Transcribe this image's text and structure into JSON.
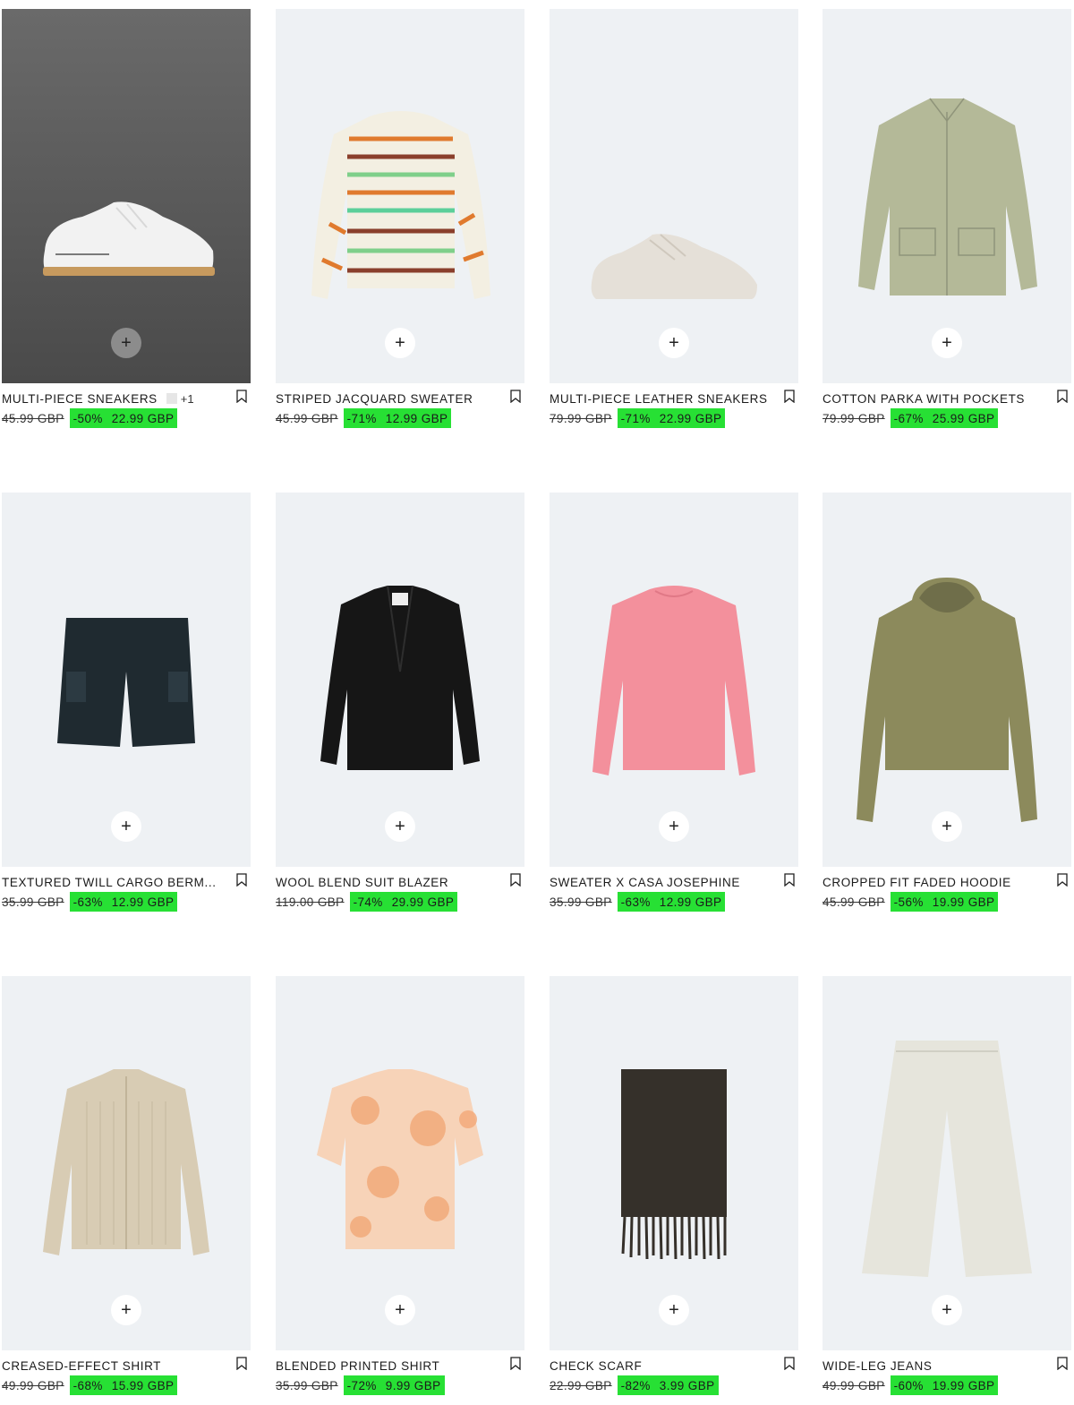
{
  "products": [
    {
      "name": "MULTI-PIECE SNEAKERS",
      "extra_colors": "+1",
      "old_price": "45.99 GBP",
      "discount": "-50%",
      "new_price": "22.99 GBP",
      "image": "white-sneaker"
    },
    {
      "name": "STRIPED JACQUARD SWEATER",
      "old_price": "45.99 GBP",
      "discount": "-71%",
      "new_price": "12.99 GBP",
      "image": "striped-sweater"
    },
    {
      "name": "MULTI-PIECE LEATHER SNEAKERS",
      "old_price": "79.99 GBP",
      "discount": "-71%",
      "new_price": "22.99 GBP",
      "image": "beige-sneaker"
    },
    {
      "name": "COTTON PARKA WITH POCKETS",
      "old_price": "79.99 GBP",
      "discount": "-67%",
      "new_price": "25.99 GBP",
      "image": "green-parka"
    },
    {
      "name": "TEXTURED TWILL CARGO BERM...",
      "old_price": "35.99 GBP",
      "discount": "-63%",
      "new_price": "12.99 GBP",
      "image": "cargo-shorts"
    },
    {
      "name": "WOOL BLEND SUIT BLAZER",
      "old_price": "119.00 GBP",
      "discount": "-74%",
      "new_price": "29.99 GBP",
      "image": "black-blazer"
    },
    {
      "name": "SWEATER X CASA JOSEPHINE",
      "old_price": "35.99 GBP",
      "discount": "-63%",
      "new_price": "12.99 GBP",
      "image": "pink-sweater"
    },
    {
      "name": "CROPPED FIT FADED HOODIE",
      "old_price": "45.99 GBP",
      "discount": "-56%",
      "new_price": "19.99 GBP",
      "image": "olive-hoodie"
    },
    {
      "name": "CREASED-EFFECT SHIRT",
      "old_price": "49.99 GBP",
      "discount": "-68%",
      "new_price": "15.99 GBP",
      "image": "beige-shirt"
    },
    {
      "name": "BLENDED PRINTED SHIRT",
      "old_price": "35.99 GBP",
      "discount": "-72%",
      "new_price": "9.99 GBP",
      "image": "tie-dye-shirt"
    },
    {
      "name": "CHECK SCARF",
      "old_price": "22.99 GBP",
      "discount": "-82%",
      "new_price": "3.99 GBP",
      "image": "brown-scarf"
    },
    {
      "name": "WIDE-LEG JEANS",
      "old_price": "49.99 GBP",
      "discount": "-60%",
      "new_price": "19.99 GBP",
      "image": "ecru-jeans"
    }
  ],
  "add_label": "+",
  "colors": {
    "sale_highlight": "#27e034",
    "image_bg": "#eef1f4"
  }
}
